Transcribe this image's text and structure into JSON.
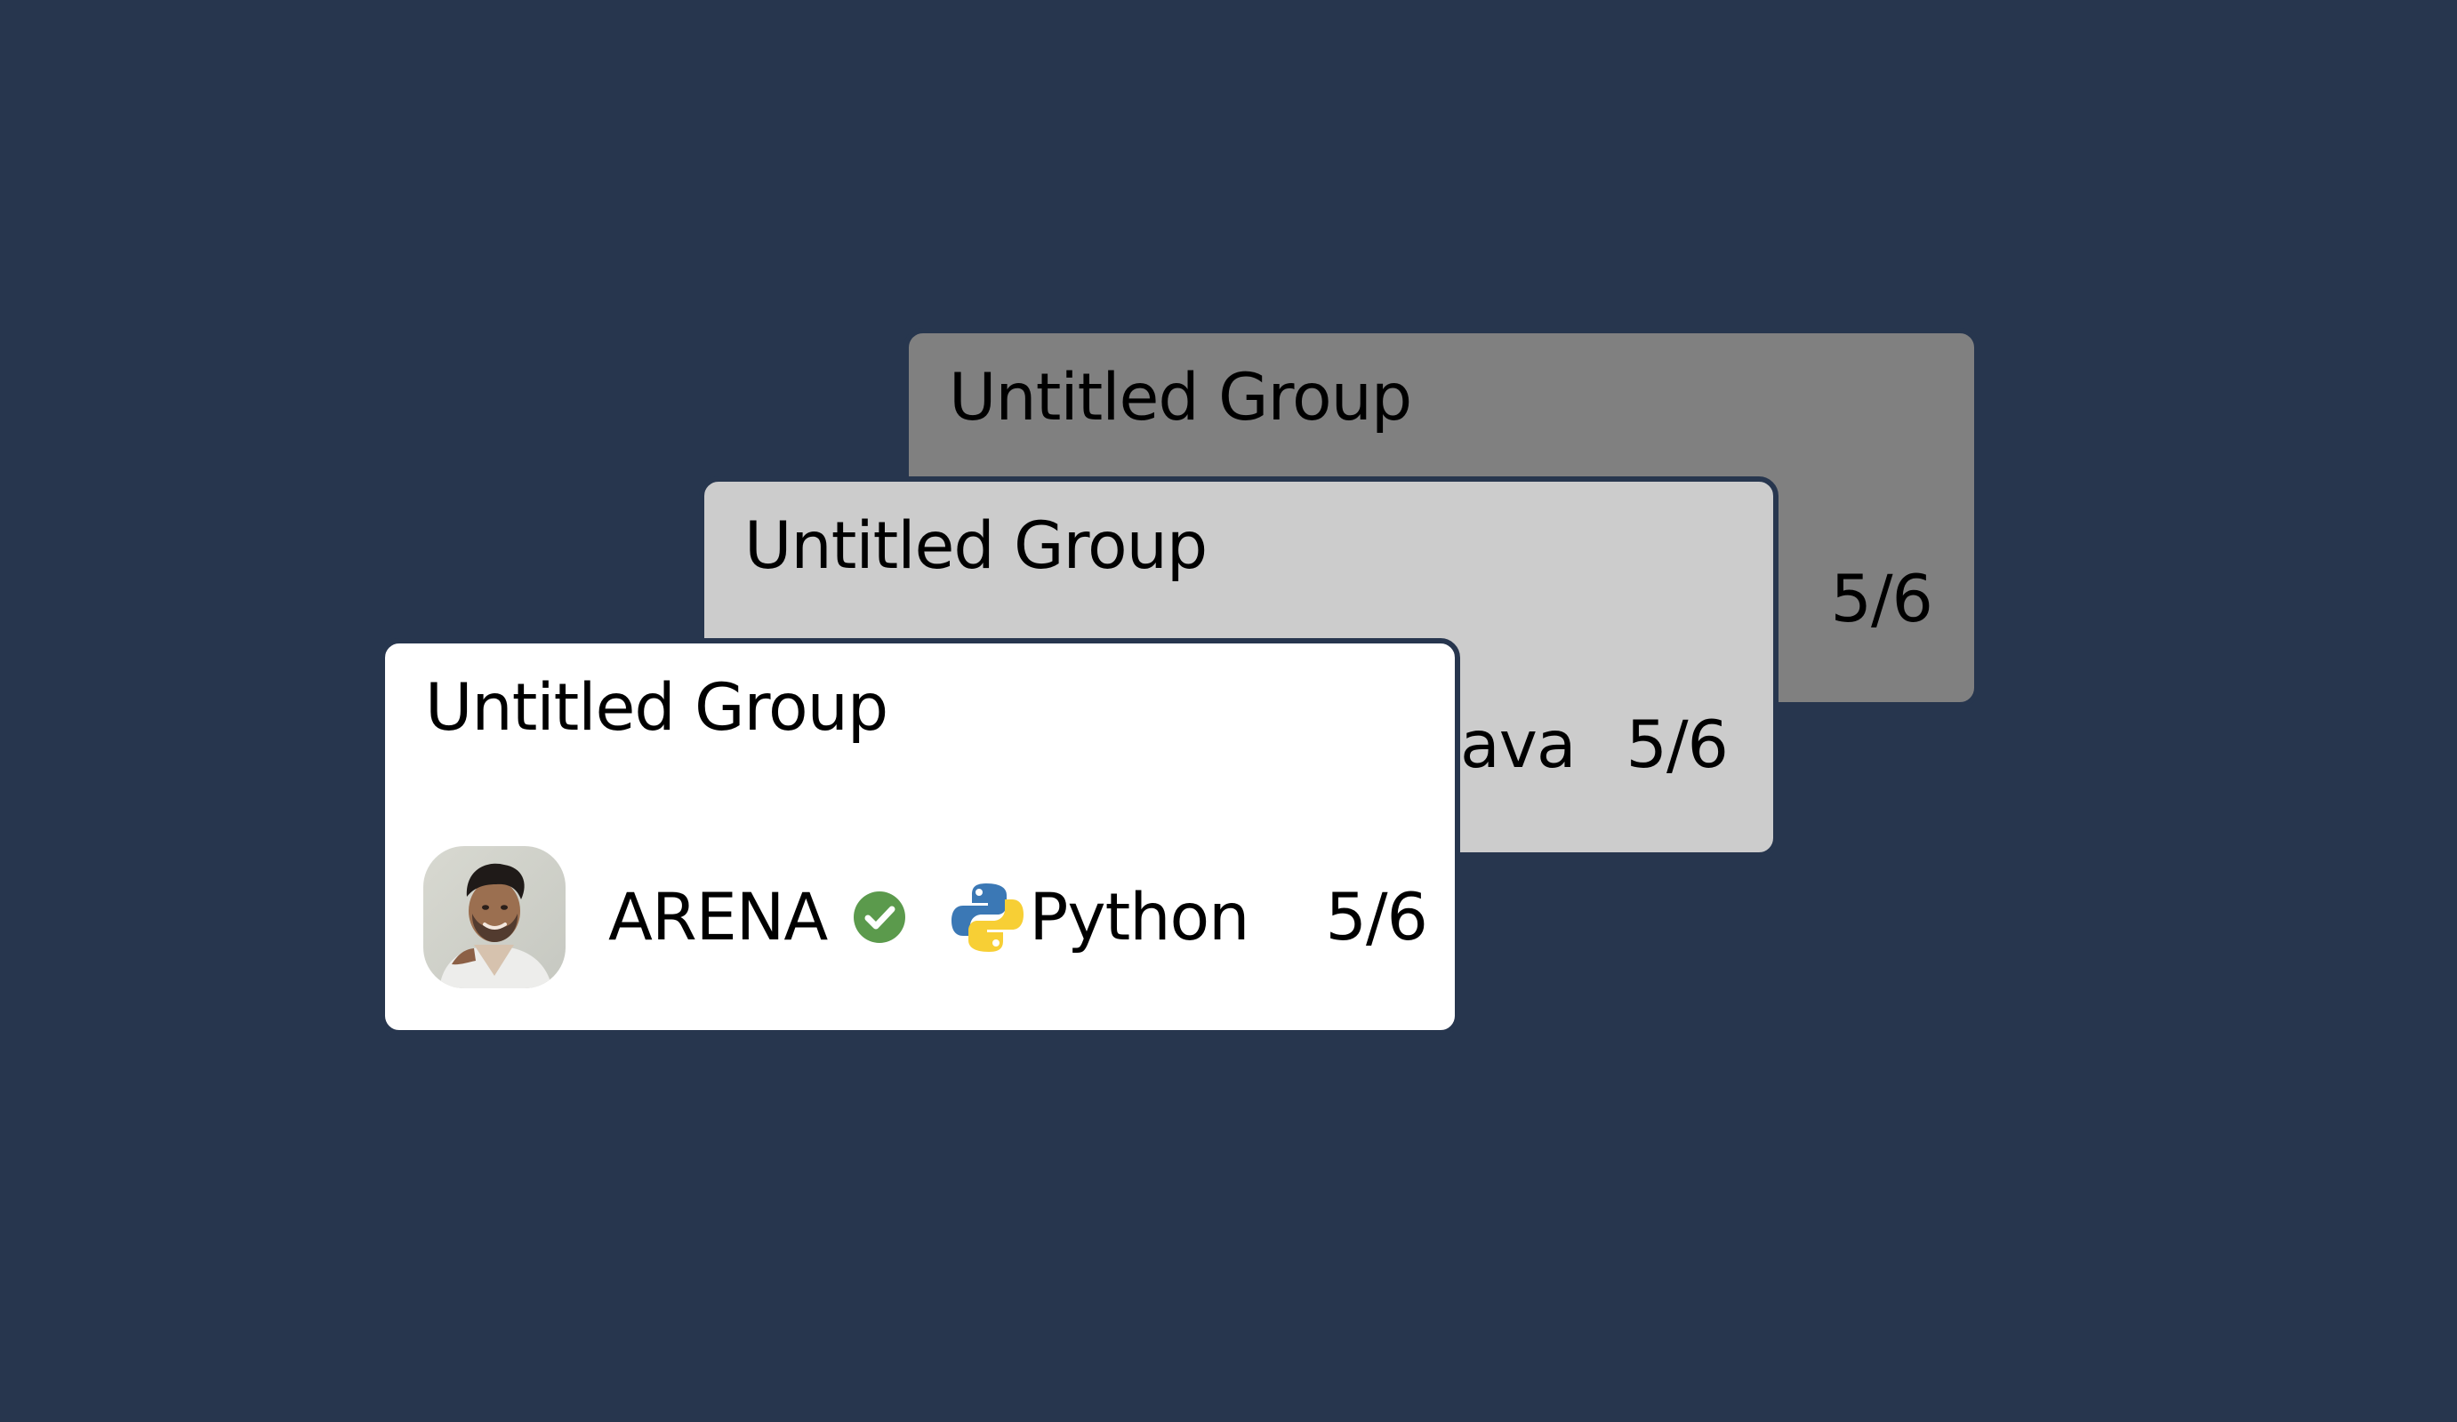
{
  "cards": [
    {
      "title": "Untitled Group",
      "count": "5/6"
    },
    {
      "title": "Untitled Group",
      "language_partial": "ava",
      "count": "5/6"
    },
    {
      "title": "Untitled Group",
      "username": "ARENA",
      "language": "Python",
      "count": "5/6",
      "avatar_icon": "avatar",
      "verified_icon": "verified-check-icon",
      "language_icon": "python-logo-icon"
    }
  ],
  "colors": {
    "background": "#27364e",
    "card_back": "#808080",
    "card_mid": "#cccccc",
    "card_front": "#ffffff",
    "verified_green": "#5b9a4c",
    "python_blue": "#3b78b5",
    "python_yellow": "#f7cf35"
  }
}
